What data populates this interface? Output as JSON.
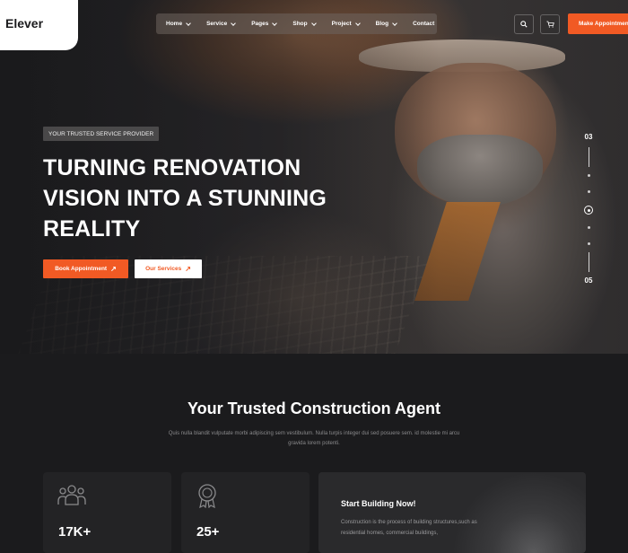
{
  "brand": {
    "name": "Elever"
  },
  "nav": {
    "items": [
      {
        "label": "Home"
      },
      {
        "label": "Service"
      },
      {
        "label": "Pages"
      },
      {
        "label": "Shop"
      },
      {
        "label": "Project"
      },
      {
        "label": "Blog"
      },
      {
        "label": "Contact"
      }
    ]
  },
  "header": {
    "cta_label": "Make Appointment",
    "search_icon": "search-icon",
    "cart_icon": "cart-icon"
  },
  "hero": {
    "tag": "YOUR TRUSTED SERVICE PROVIDER",
    "title": "TURNING RENOVATION VISION INTO A STUNNING REALITY",
    "primary_button": "Book Appointment",
    "secondary_button": "Our Services",
    "slider": {
      "current": "03",
      "total": "05"
    }
  },
  "about": {
    "title": "Your Trusted Construction Agent",
    "subtitle": "Quis nulla blandit vulputate morbi adipiscing sem vestibulum. Nulla turpis integer dui sed posuere sem. id molestie mi arcu gravida lorem potenti.",
    "stats": [
      {
        "value": "17K+",
        "icon": "users-icon"
      },
      {
        "value": "25+",
        "icon": "award-icon"
      }
    ],
    "promo": {
      "title": "Start Building Now!",
      "text": "Construction is the process of building structures,such as residential homes, commercial buildings,"
    }
  },
  "colors": {
    "accent": "#f15a24",
    "background": "#1b1b1d",
    "card": "#232325"
  }
}
